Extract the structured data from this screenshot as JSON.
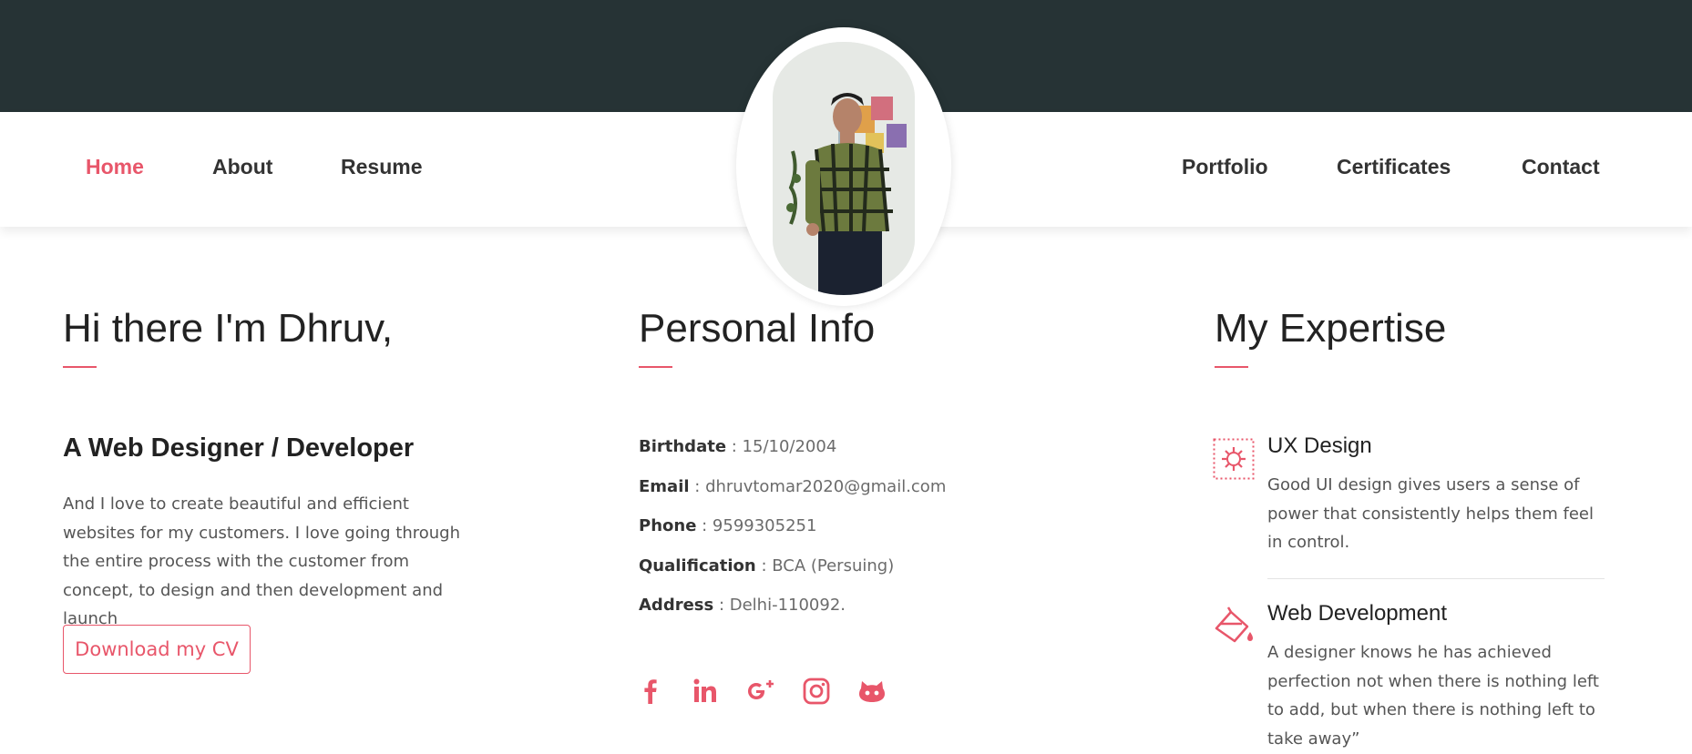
{
  "nav": {
    "left": [
      {
        "label": "Home",
        "active": true
      },
      {
        "label": "About",
        "active": false
      },
      {
        "label": "Resume",
        "active": false
      }
    ],
    "right": [
      {
        "label": "Portfolio",
        "active": false
      },
      {
        "label": "Certificates",
        "active": false
      },
      {
        "label": "Contact",
        "active": false
      }
    ]
  },
  "intro": {
    "heading": "Hi there I'm Dhruv,",
    "subheading": "A Web Designer / Developer",
    "bio": "And I love to create beautiful and efficient websites for my customers. I love going through the entire process with the customer from concept, to design and then development and launch",
    "cv_button": "Download my CV"
  },
  "personal": {
    "heading": "Personal Info",
    "rows": [
      {
        "label": "Birthdate",
        "sep": " : ",
        "value": "15/10/2004"
      },
      {
        "label": "Email",
        "sep": " : ",
        "value": "dhruvtomar2020@gmail.com"
      },
      {
        "label": "Phone",
        "sep": " : ",
        "value": "9599305251"
      },
      {
        "label": "Qualification",
        "sep": " : ",
        "value": "BCA (Persuing)"
      },
      {
        "label": "Address",
        "sep": " : ",
        "value": "Delhi-110092."
      }
    ],
    "social_icons": [
      "facebook-icon",
      "linkedin-icon",
      "google-plus-icon",
      "instagram-icon",
      "github-icon"
    ]
  },
  "expertise": {
    "heading": "My Expertise",
    "items": [
      {
        "icon": "gear-icon",
        "title": "UX Design",
        "desc": "Good UI design gives users a sense of power that consistently helps them feel in control."
      },
      {
        "icon": "paint-bucket-icon",
        "title": "Web Development",
        "desc": "A designer knows he has achieved perfection not when there is nothing left to add, but when there is nothing left to take away”"
      }
    ]
  },
  "colors": {
    "accent": "#e8566a",
    "topbar": "#263335"
  }
}
